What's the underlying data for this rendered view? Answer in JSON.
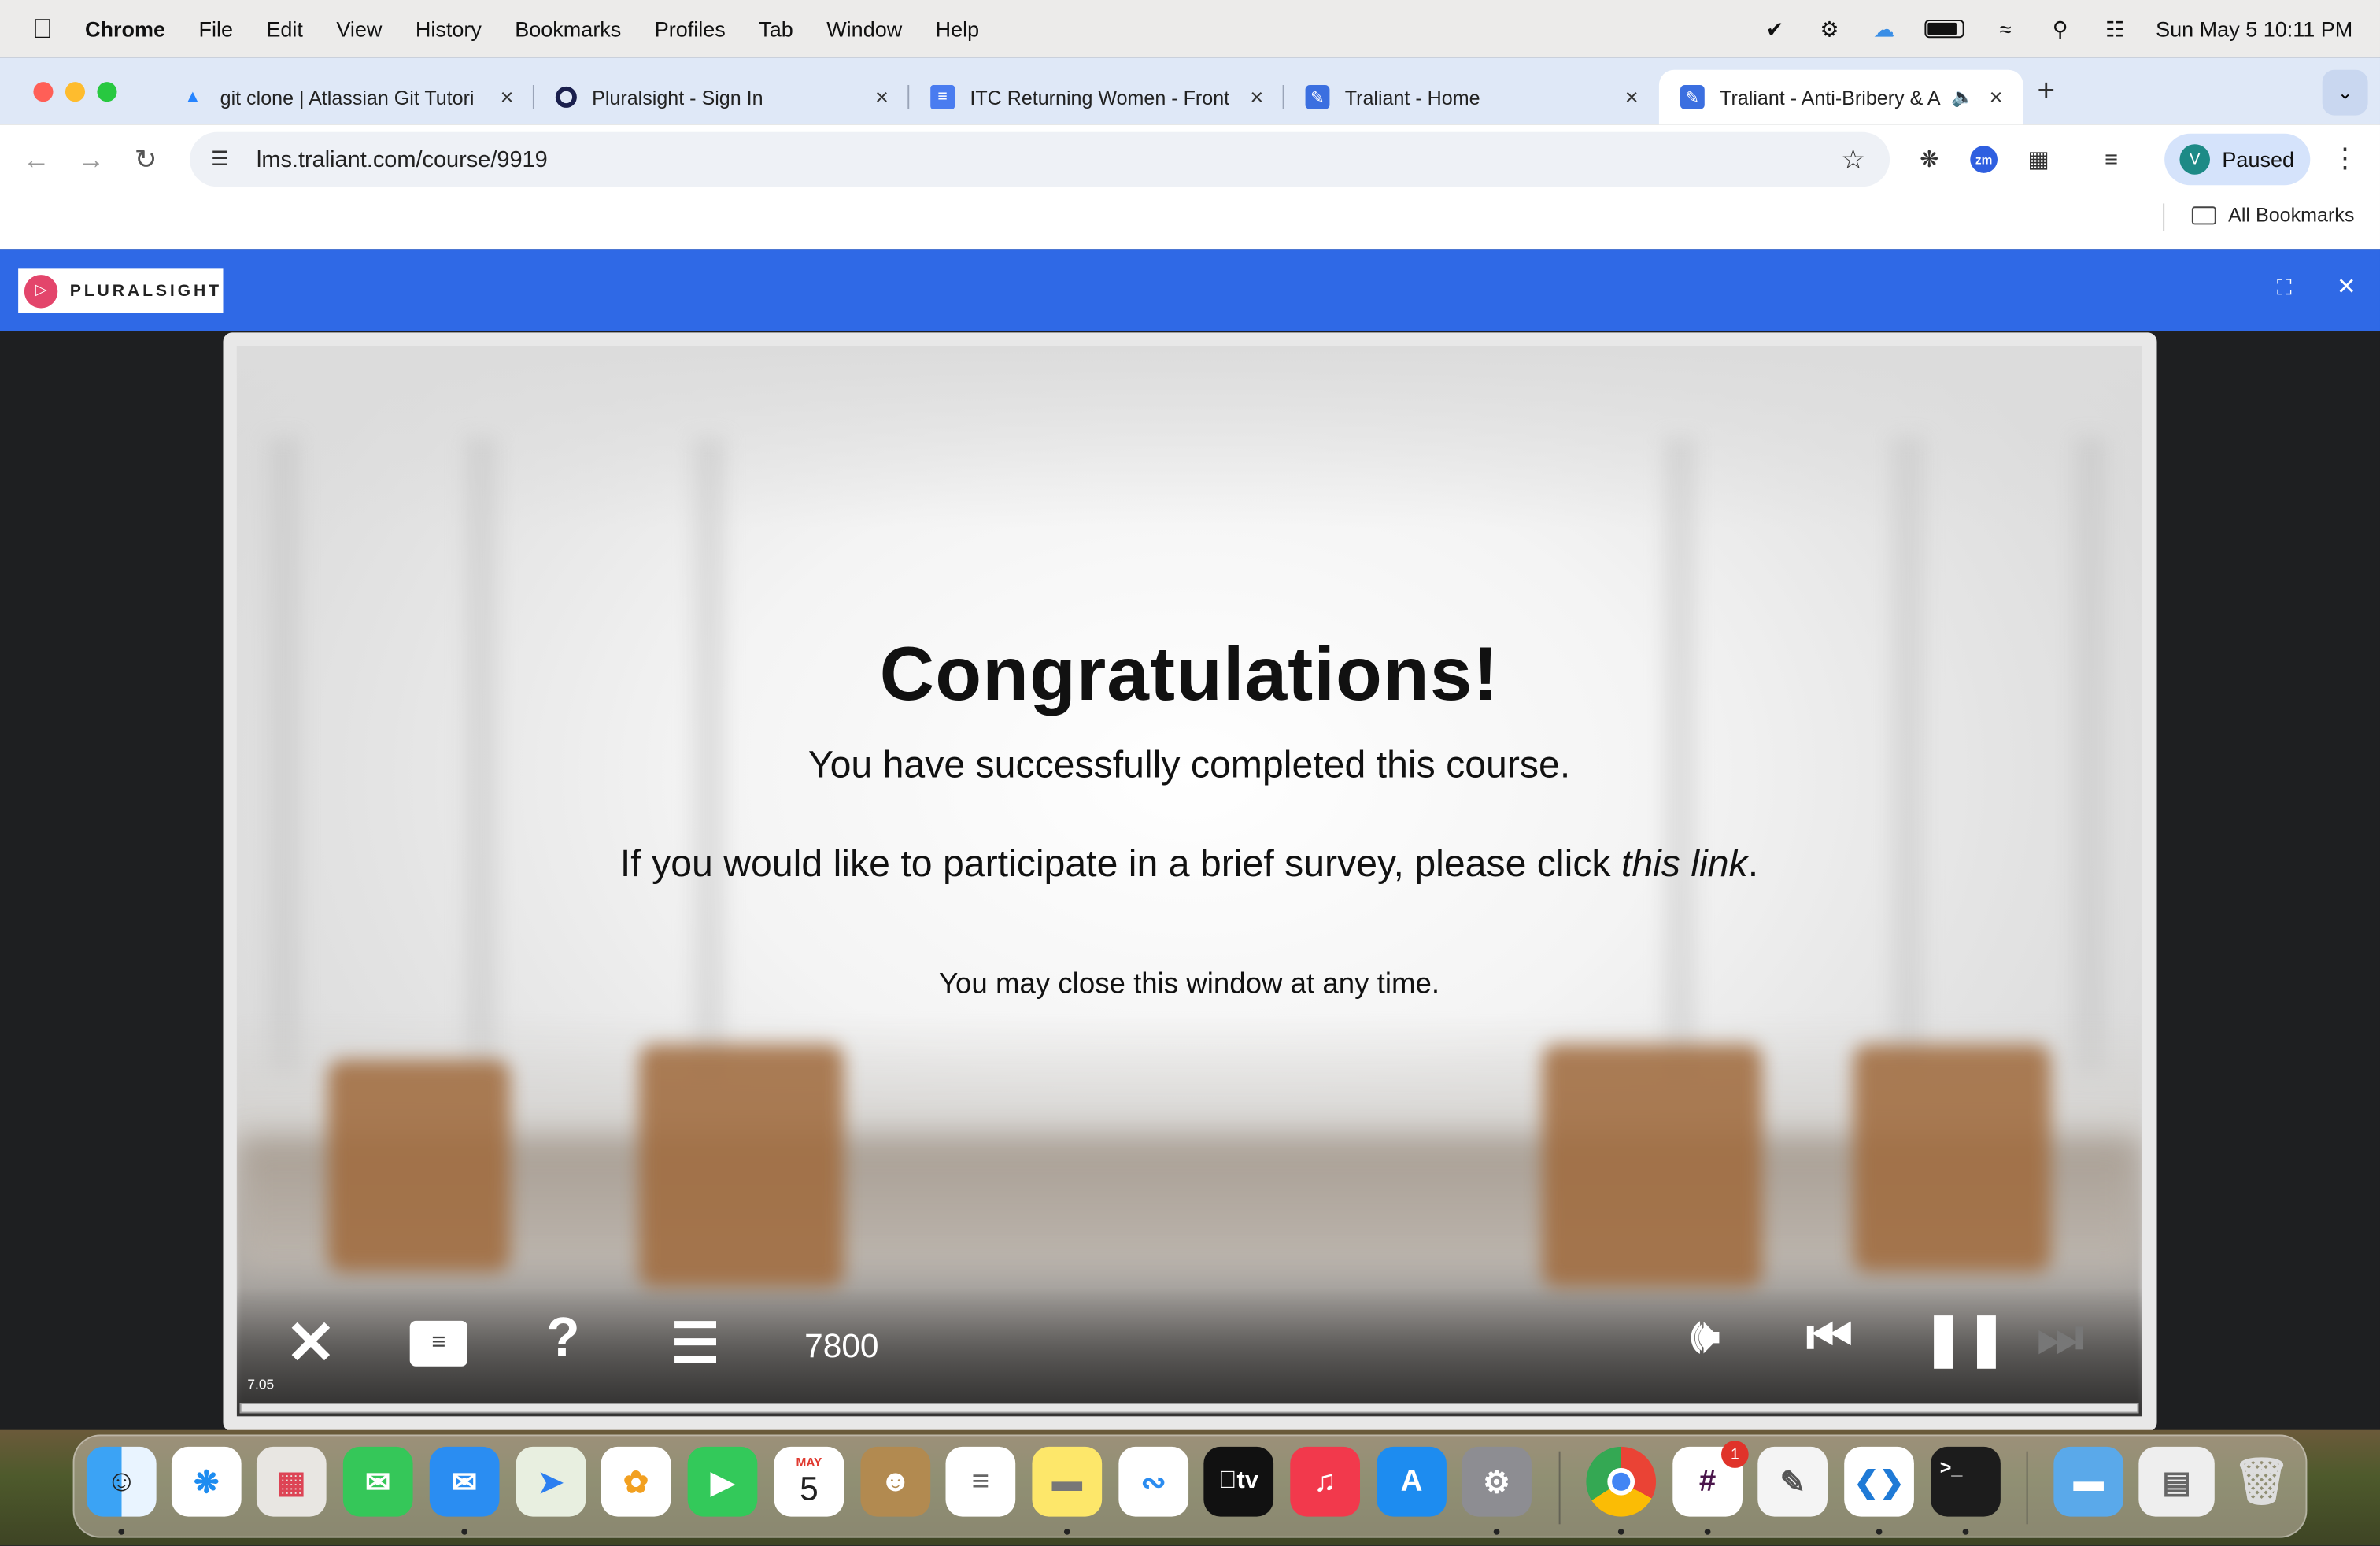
{
  "menubar": {
    "app": "Chrome",
    "items": [
      "File",
      "Edit",
      "View",
      "History",
      "Bookmarks",
      "Profiles",
      "Tab",
      "Window",
      "Help"
    ],
    "clock": "Sun May 5  10:11 PM"
  },
  "tabs": [
    {
      "title": "git clone | Atlassian Git Tutori",
      "favicon": "atlassian-icon"
    },
    {
      "title": "Pluralsight - Sign In",
      "favicon": "pluralsight-icon"
    },
    {
      "title": "ITC Returning Women - Front",
      "favicon": "docs-icon"
    },
    {
      "title": "Traliant - Home",
      "favicon": "traliant-icon"
    },
    {
      "title": "Traliant - Anti-Bribery & A",
      "favicon": "traliant-icon",
      "active": true
    }
  ],
  "toolbar": {
    "url": "lms.traliant.com/course/9919",
    "profile_initial": "V",
    "profile_status": "Paused",
    "zoom_ext": "zm"
  },
  "bookmarks": {
    "all_label": "All Bookmarks"
  },
  "pluralsight": {
    "logo_text": "PLURALSIGHT"
  },
  "slide": {
    "title": "Congratulations!",
    "line1": "You have successfully completed this course.",
    "line2_prefix": "If you would like to participate in a brief survey, please click ",
    "line2_link": "this link",
    "line2_suffix": ".",
    "line3": "You may close this window at any time."
  },
  "player": {
    "counter": "7800",
    "version": "7.05"
  },
  "dock": {
    "calendar_month": "MAY",
    "calendar_day": "5",
    "slack_badge": "1",
    "appletv_label": "tv"
  },
  "colors": {
    "ps_bar": "#2f69e6",
    "tabstrip": "#dfe8f7",
    "accent_pink": "#e3456b"
  }
}
